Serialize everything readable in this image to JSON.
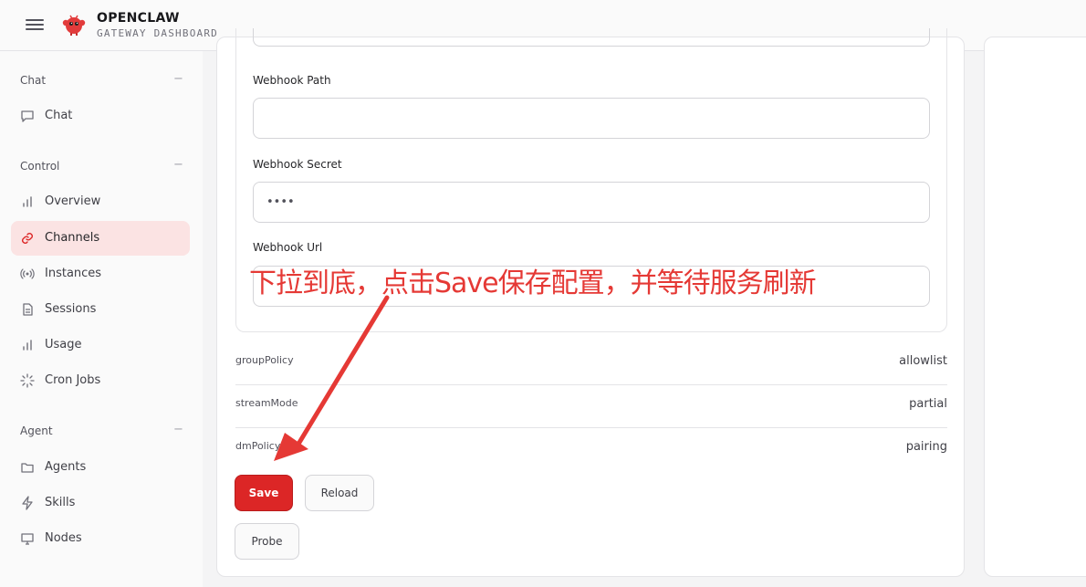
{
  "header": {
    "title": "OPENCLAW",
    "subtitle": "GATEWAY DASHBOARD",
    "menu_icon": "hamburger-icon",
    "logo_icon": "lobster-mascot-icon"
  },
  "sidebar": {
    "sections": [
      {
        "label": "Chat",
        "collapse": "−",
        "items": [
          {
            "label": "Chat",
            "icon": "chat-bubble-icon"
          }
        ]
      },
      {
        "label": "Control",
        "collapse": "−",
        "items": [
          {
            "label": "Overview",
            "icon": "bar-chart-icon"
          },
          {
            "label": "Channels",
            "icon": "link-icon",
            "active": true
          },
          {
            "label": "Instances",
            "icon": "radio-signal-icon"
          },
          {
            "label": "Sessions",
            "icon": "document-icon"
          },
          {
            "label": "Usage",
            "icon": "bar-chart-icon"
          },
          {
            "label": "Cron Jobs",
            "icon": "loader-icon"
          }
        ]
      },
      {
        "label": "Agent",
        "collapse": "−",
        "items": [
          {
            "label": "Agents",
            "icon": "folder-icon"
          },
          {
            "label": "Skills",
            "icon": "lightning-icon"
          },
          {
            "label": "Nodes",
            "icon": "monitor-icon"
          }
        ]
      }
    ]
  },
  "form": {
    "fields": [
      {
        "label": "Webhook Path",
        "value": ""
      },
      {
        "label": "Webhook Secret",
        "value": "••••"
      },
      {
        "label": "Webhook Url",
        "value": ""
      }
    ],
    "kv": [
      {
        "key": "groupPolicy",
        "value": "allowlist"
      },
      {
        "key": "streamMode",
        "value": "partial"
      },
      {
        "key": "dmPolicy",
        "value": "pairing"
      }
    ],
    "buttons": {
      "save": "Save",
      "reload": "Reload",
      "probe": "Probe"
    }
  },
  "annotation": {
    "text": "下拉到底，点击Save保存配置，并等待服务刷新",
    "color": "#e53935"
  },
  "colors": {
    "accent": "#dc2626",
    "active_bg": "#fbe3e3"
  }
}
